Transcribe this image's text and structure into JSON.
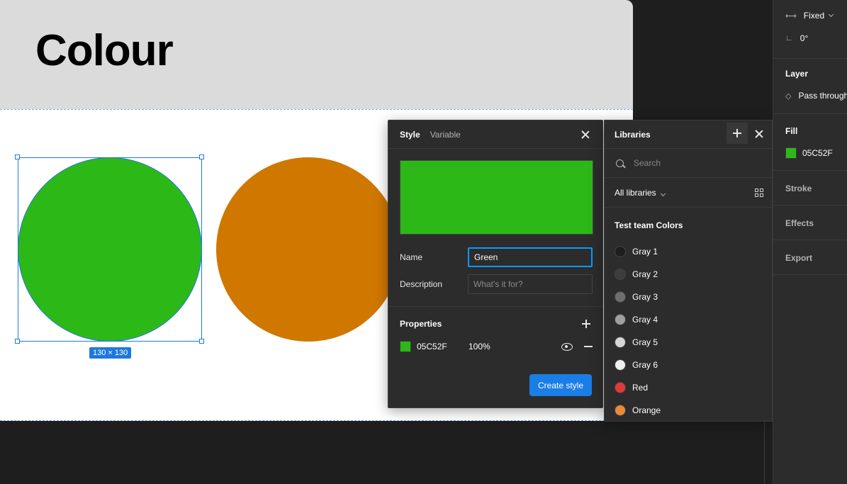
{
  "canvas": {
    "frame_title": "Colour",
    "size_badge": "130 × 130",
    "colors": {
      "green": "#2cb918",
      "orange": "#d07700",
      "selection": "#1e78e0"
    }
  },
  "style_dialog": {
    "tabs": [
      "Style",
      "Variable"
    ],
    "active_tab": "Style",
    "preview_color": "#2cb918",
    "name_label": "Name",
    "name_value": "Green",
    "description_label": "Description",
    "description_placeholder": "What's it for?",
    "properties_title": "Properties",
    "property": {
      "hex": "05C52F",
      "opacity": "100%",
      "color": "#2cb918"
    },
    "create_button": "Create style"
  },
  "libraries": {
    "title": "Libraries",
    "search_placeholder": "Search",
    "filter_label": "All libraries",
    "section_title": "Test team Colors",
    "items": [
      {
        "name": "Gray 1",
        "color": "#1e1e1e"
      },
      {
        "name": "Gray 2",
        "color": "#3d3d3d"
      },
      {
        "name": "Gray 3",
        "color": "#6e6e6e"
      },
      {
        "name": "Gray 4",
        "color": "#a0a0a0"
      },
      {
        "name": "Gray 5",
        "color": "#d6d6d6"
      },
      {
        "name": "Gray 6",
        "color": "#efefef"
      },
      {
        "name": "Red",
        "color": "#e5383b"
      },
      {
        "name": "Orange",
        "color": "#ea8a35"
      }
    ]
  },
  "right_panel": {
    "width_mode": "Fixed",
    "rotation": "0°",
    "layer_title": "Layer",
    "blend_mode": "Pass through",
    "fill_title": "Fill",
    "fill_hex": "05C52F",
    "fill_color": "#2cb918",
    "stroke_title": "Stroke",
    "effects_title": "Effects",
    "export_title": "Export"
  }
}
